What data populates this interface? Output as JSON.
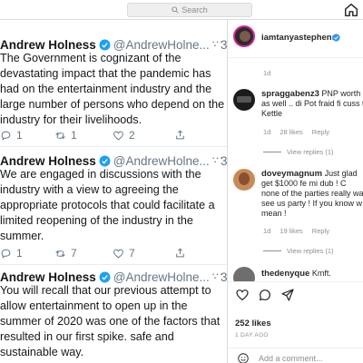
{
  "topbar": {
    "search_placeholder": "Search",
    "search_icon": "search-icon",
    "home_icon": "home-icon"
  },
  "tweets": [
    {
      "name": "Andrew Holness",
      "handle": "@AndrewHolne...",
      "time": "· 3h",
      "lines": [
        "The Government is cognizant of the",
        "devastating impact that the pandemic has",
        "had on the entertainment industry and the",
        "large number of persons who depend on the",
        "industry for their livelihoods."
      ],
      "replies": "1",
      "retweets": "1",
      "likes": "2"
    },
    {
      "name": "Andrew Holness",
      "handle": "@AndrewHolne...",
      "time": "· 3h",
      "lines": [
        "We are engaged in discussions with the",
        "industry with a view to agreeing the",
        "appropriate protocols that could facilitate a",
        "limited reopening of the industry in the",
        "summer."
      ],
      "replies": "1",
      "retweets": "7",
      "likes": "7"
    },
    {
      "name": "Andrew Holness",
      "handle": "@AndrewHolne...",
      "time": "· 3h",
      "lines": [
        "You will recall that our previous attempt to",
        "allow entertainment to open up in the",
        "summer of 2020 was one of the factors that",
        "resulted in our first spike. safe and",
        "sustainable way."
      ],
      "replies": "",
      "retweets": "",
      "likes": ""
    }
  ],
  "instagram": {
    "author": "iamtanyastephens",
    "author_age": "1d",
    "comments": [
      {
        "user": "spraggabenz3",
        "lines": [
          "PNP worth",
          "as well .. di Pot fraid fi cuss t",
          "Kettle"
        ],
        "age": "1d",
        "likes": "28 likes",
        "reply": "Reply",
        "view_replies": "View replies (1)"
      },
      {
        "user": "doveymagnum",
        "lines": [
          "Just glad",
          "get $1000 fe mi dub ! C",
          "none of the parties really wa",
          "see us party ! If you know w",
          "mean !"
        ],
        "age": "1d",
        "likes": "19 likes",
        "reply": "Reply",
        "view_replies": "View replies (1)"
      },
      {
        "user": "thedenyque",
        "lines": [
          "Kmft."
        ],
        "age": "",
        "likes": "",
        "reply": "",
        "view_replies": ""
      }
    ],
    "likes_count": "252 likes",
    "post_age": "1 DAY AGO",
    "add_comment_placeholder": "Add a comment..."
  },
  "colors": {
    "twitter_blue": "#1da1f2",
    "ig_verified": "#3897f0",
    "text": "#14171a",
    "muted": "#657786"
  }
}
